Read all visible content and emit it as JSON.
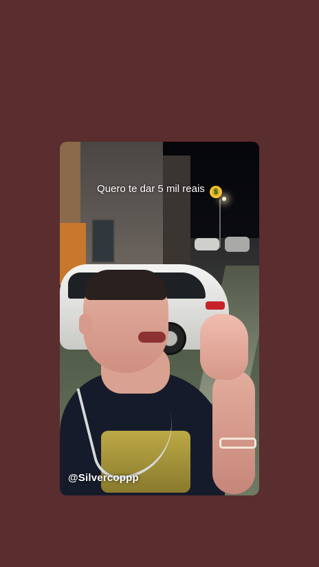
{
  "story": {
    "caption": "Quero te dar 5 mil reais",
    "caption_emoji": "$",
    "caption_emoji_name": "money-mouth-face-icon",
    "watermark": "@Silvercoppp"
  },
  "colors": {
    "background": "#5a2d2e",
    "caption_text": "#ffffff"
  }
}
